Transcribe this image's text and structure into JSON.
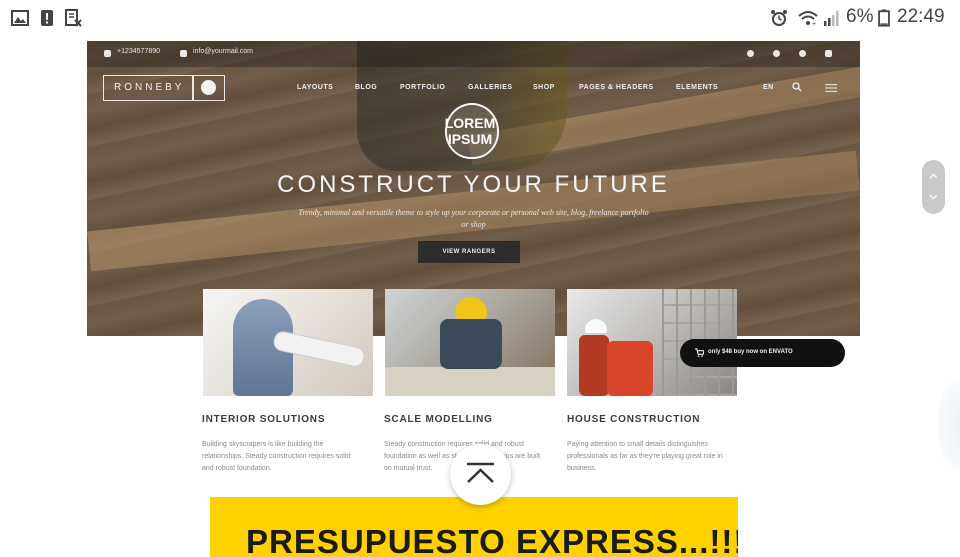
{
  "status_bar": {
    "battery": "6%",
    "time": "22:49",
    "left_icons": [
      "image-icon",
      "alert-icon",
      "document-x-icon"
    ],
    "right_icons": [
      "alarm-icon",
      "wifi-icon",
      "signal-icon",
      "battery-icon"
    ]
  },
  "site": {
    "topbar": {
      "phone": "+1234577890",
      "email": "info@yourmail.com"
    },
    "logo": "RONNEBY",
    "nav": [
      "LAYOUTS",
      "BLOG",
      "PORTFOLIO",
      "GALLERIES",
      "SHOP",
      "PAGES & HEADERS",
      "ELEMENTS"
    ],
    "lang": "EN",
    "badge_text": "LOREM IPSUM",
    "hero_title": "CONSTRUCT YOUR FUTURE",
    "hero_subtitle": "Trendy, minimal and versatile theme to style up your corporate or personal web site, blog, freelance portfolio or shop",
    "hero_button": "VIEW RANGERS",
    "cards": [
      {
        "title": "INTERIOR SOLUTIONS",
        "text": "Building skyscrapers is like building the relationships. Steady construction requires solid and robust foundation."
      },
      {
        "title": "SCALE MODELLING",
        "text": "Steady construction requires solid and robust foundation as well as steady relationships are built on mutual trust."
      },
      {
        "title": "HOUSE CONSTRUCTION",
        "text": "Paying attention to small details distinguishes professionals as far as they're playing great role in business."
      }
    ],
    "buy_pill": "only $48 buy now on  ENVATO"
  },
  "scroll_to_top": "chevron-up-icon",
  "banner": {
    "text": "PRESUPUESTO EXPRESS...!!!",
    "color": "#ffd100"
  }
}
